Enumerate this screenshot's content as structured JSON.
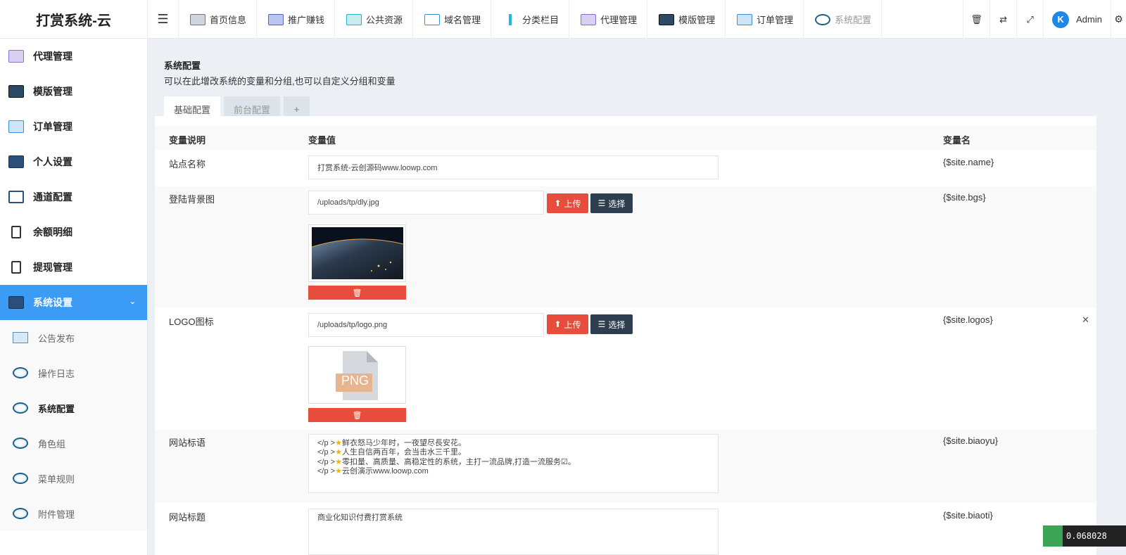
{
  "app": {
    "title": "打赏系统-云"
  },
  "topnav": {
    "items": [
      {
        "label": "首页信息",
        "icon": "computer-icon"
      },
      {
        "label": "推广赚钱",
        "icon": "promote-icon"
      },
      {
        "label": "公共资源",
        "icon": "resources-icon"
      },
      {
        "label": "域名管理",
        "icon": "domain-icon"
      },
      {
        "label": "分类栏目",
        "icon": "category-icon"
      },
      {
        "label": "代理管理",
        "icon": "agent-icon"
      },
      {
        "label": "模版管理",
        "icon": "template-icon"
      },
      {
        "label": "订单管理",
        "icon": "order-icon"
      },
      {
        "label": "系统配置",
        "icon": "ring-icon"
      }
    ],
    "right": {
      "trash": "🗑",
      "translate": "⇄",
      "fullscreen": "⤢",
      "user": "Admin",
      "avatar_letter": "K",
      "settings": "⚙"
    }
  },
  "sidebar": {
    "items": [
      {
        "label": "代理管理"
      },
      {
        "label": "模版管理"
      },
      {
        "label": "订单管理"
      },
      {
        "label": "个人设置"
      },
      {
        "label": "通道配置"
      },
      {
        "label": "余额明细"
      },
      {
        "label": "提现管理"
      },
      {
        "label": "系统设置"
      }
    ],
    "subitems": [
      {
        "label": "公告发布"
      },
      {
        "label": "操作日志"
      },
      {
        "label": "系统配置"
      },
      {
        "label": "角色组"
      },
      {
        "label": "菜单规则"
      },
      {
        "label": "附件管理"
      }
    ]
  },
  "page": {
    "title": "系统配置",
    "subtitle": "可以在此增改系统的变量和分组,也可以自定义分组和变量",
    "tabs": [
      {
        "label": "基础配置"
      },
      {
        "label": "前台配置"
      },
      {
        "label": "+"
      }
    ]
  },
  "table": {
    "headers": {
      "desc": "变量说明",
      "value": "变量值",
      "name": "变量名"
    },
    "rows": {
      "site_name": {
        "label": "站点名称",
        "value": "打赏系统-云创源码www.loowp.com",
        "var": "{$site.name}"
      },
      "bg": {
        "label": "登陆背景图",
        "value": "/uploads/tp/dly.jpg",
        "var": "{$site.bgs}"
      },
      "logo": {
        "label": "LOGO图标",
        "value": "/uploads/tp/logo.png",
        "var": "{$site.logos}",
        "png_text": "PNG"
      },
      "slogan": {
        "label": "网站标语",
        "lines": [
          {
            "prefix": "</p >",
            "text": "鲜衣怒马少年时，一夜望尽長安花。"
          },
          {
            "prefix": "</p >",
            "text": "人生自信两百年，会当击水三千里。"
          },
          {
            "prefix": "</p >",
            "text": "零扣量、高质量、高稳定性的系统，主打一流品牌,打造一流服务☑。"
          },
          {
            "prefix": "</p >",
            "text": "云创演示www.loowp.com"
          }
        ],
        "var": "{$site.biaoyu}"
      },
      "title": {
        "label": "网站标题",
        "value": "商业化知识付费打赏系统",
        "var": "{$site.biaoti}"
      }
    },
    "buttons": {
      "upload": "上传",
      "select": "选择"
    }
  },
  "corner_counter": "0.068028"
}
